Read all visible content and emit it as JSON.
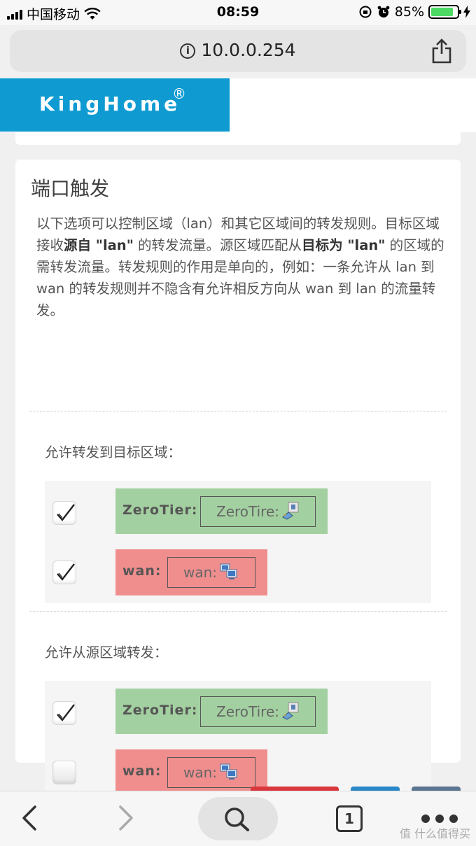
{
  "status_bar": {
    "carrier": "中国移动",
    "time": "08:59",
    "battery": "85%",
    "battery_level": 0.85
  },
  "address_bar": {
    "url": "10.0.0.254"
  },
  "brand": {
    "name": "KingHome",
    "reg_mark": "®"
  },
  "section": {
    "title": "端口触发",
    "description_parts": [
      "以下选项可以控制区域（lan）和其它区域间的转发规则。目标区域接收",
      "源自 \"lan\"",
      " 的转发流量。源区域匹配从",
      "目标为 \"lan\"",
      " 的区域的需转发流量。转发规则的作用是单向的，例如：一条允许从 lan 到 wan 的转发规则并不隐含有允许相反方向从 wan 到 lan 的流量转发。"
    ],
    "dest_label": "允许转发到目标区域：",
    "src_label": "允许从源区域转发：",
    "dest_zones": [
      {
        "name": "ZeroTier:",
        "badge": "ZeroTire:",
        "checked": true,
        "color": "green",
        "icon": "network-adapter-icon"
      },
      {
        "name": "wan:",
        "badge": "wan:",
        "checked": true,
        "color": "red",
        "icon": "computers-icon"
      }
    ],
    "src_zones": [
      {
        "name": "ZeroTier:",
        "badge": "ZeroTire:",
        "checked": true,
        "color": "green",
        "icon": "network-adapter-icon"
      },
      {
        "name": "wan:",
        "badge": "wan:",
        "checked": false,
        "color": "red",
        "icon": "computers-icon"
      }
    ]
  },
  "toolbar": {
    "tab_count": "1"
  },
  "watermark": "值 什么值得买"
}
